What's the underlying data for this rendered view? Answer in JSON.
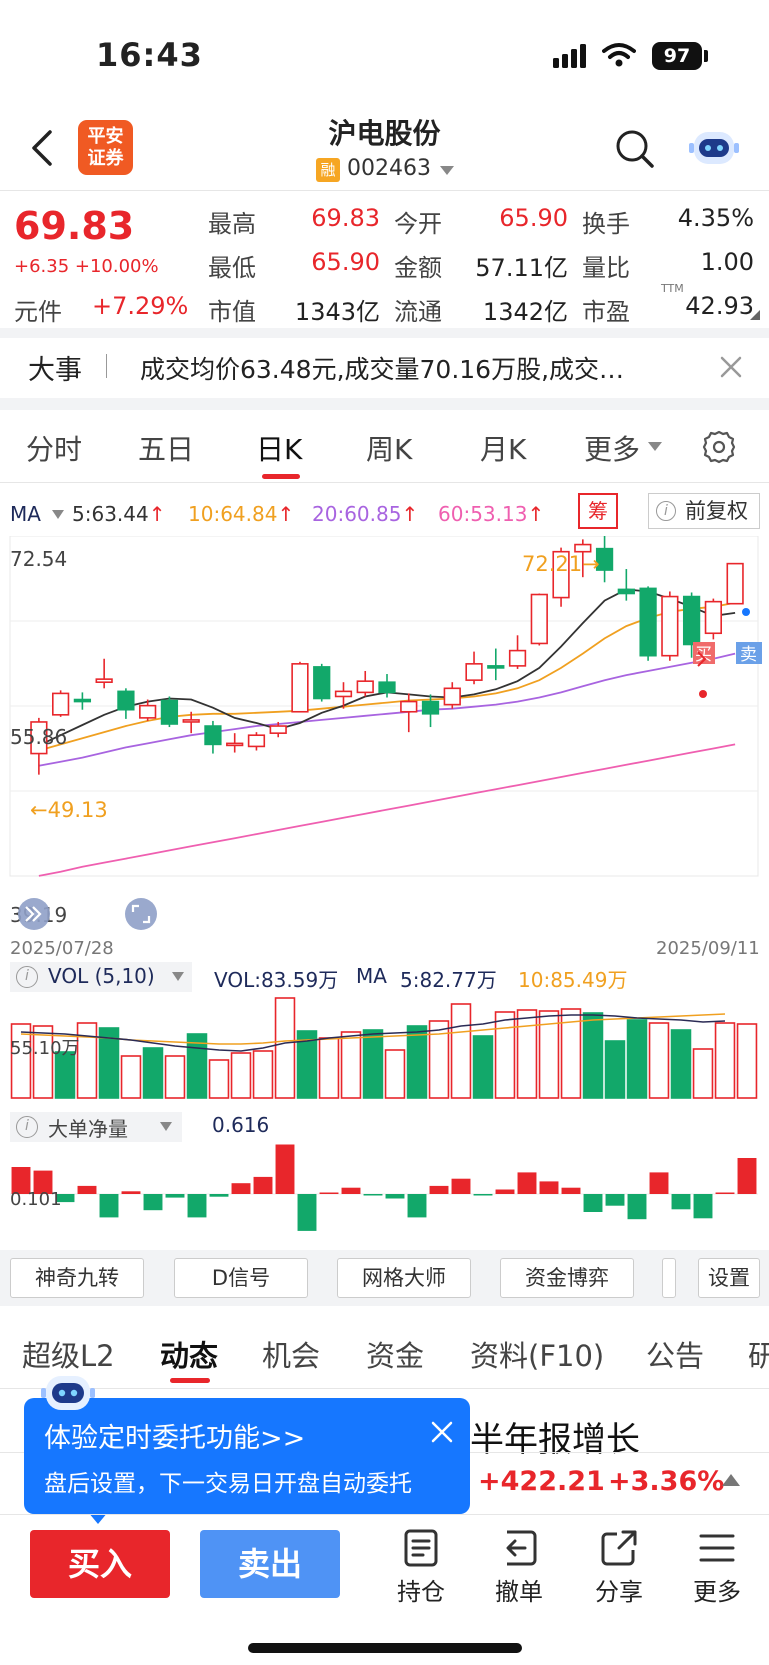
{
  "status_bar": {
    "time": "16:43",
    "battery": "97"
  },
  "header": {
    "broker_logo": "平安\n证券",
    "stock_name": "沪电股份",
    "margin_badge": "融",
    "stock_code": "002463"
  },
  "quote": {
    "price": "69.83",
    "change": "+6.35 +10.00%",
    "extra_label": "元件",
    "extra_value": "+7.29%",
    "rows": [
      [
        {
          "label": "最高",
          "value": "69.83",
          "color": "red"
        },
        {
          "label": "今开",
          "value": "65.90",
          "color": "red"
        },
        {
          "label": "换手",
          "value": "4.35%",
          "color": "black"
        }
      ],
      [
        {
          "label": "最低",
          "value": "65.90",
          "color": "red"
        },
        {
          "label": "金额",
          "value": "57.11亿",
          "color": "black"
        },
        {
          "label": "量比",
          "value": "1.00",
          "color": "black"
        }
      ],
      [
        {
          "label": "市值",
          "value": "1343亿",
          "color": "black"
        },
        {
          "label": "流通",
          "value": "1342亿",
          "color": "black"
        },
        {
          "label": "市盈",
          "value": "42.93",
          "color": "black"
        }
      ]
    ],
    "pe_suffix": "TTM"
  },
  "news": {
    "tag": "大事",
    "text": "成交均价63.48元,成交量70.16万股,成交…"
  },
  "period_tabs": [
    "分时",
    "五日",
    "日K",
    "周K",
    "月K",
    "更多"
  ],
  "active_period": "日K",
  "ma_legend": {
    "label": "MA",
    "ma5": "5:63.44",
    "ma10": "10:64.84",
    "ma20": "20:60.85",
    "ma60": "60:53.13",
    "arrow": "↑"
  },
  "chips_button": "筹",
  "adjust_button": "前复权",
  "kline": {
    "y_labels": [
      "72.54",
      "55.86",
      "39.19"
    ],
    "start_date": "2025/07/28",
    "end_date": "2025/09/11",
    "low_annotation": "49.13",
    "high_annotation": "72.21",
    "buy_mark": "买",
    "sell_mark": "卖",
    "candles": [
      {
        "o": 51.2,
        "c": 54.3,
        "h": 54.7,
        "l": 49.13
      },
      {
        "o": 55.0,
        "c": 57.1,
        "h": 57.4,
        "l": 54.8
      },
      {
        "o": 56.5,
        "c": 56.3,
        "h": 57.2,
        "l": 55.5
      },
      {
        "o": 58.2,
        "c": 58.5,
        "h": 60.5,
        "l": 57.6
      },
      {
        "o": 57.3,
        "c": 55.5,
        "h": 57.6,
        "l": 54.6
      },
      {
        "o": 54.7,
        "c": 55.9,
        "h": 56.5,
        "l": 54.4
      },
      {
        "o": 56.4,
        "c": 54.1,
        "h": 56.8,
        "l": 53.8
      },
      {
        "o": 54.3,
        "c": 54.5,
        "h": 55.3,
        "l": 53.2
      },
      {
        "o": 53.9,
        "c": 52.1,
        "h": 54.4,
        "l": 51.2
      },
      {
        "o": 52.0,
        "c": 52.2,
        "h": 53.2,
        "l": 51.3
      },
      {
        "o": 51.9,
        "c": 53.0,
        "h": 53.3,
        "l": 51.5
      },
      {
        "o": 53.2,
        "c": 53.9,
        "h": 54.3,
        "l": 52.8
      },
      {
        "o": 55.3,
        "c": 60.0,
        "h": 60.2,
        "l": 55.3
      },
      {
        "o": 59.7,
        "c": 56.6,
        "h": 60.0,
        "l": 56.3
      },
      {
        "o": 56.8,
        "c": 57.3,
        "h": 58.2,
        "l": 55.6
      },
      {
        "o": 57.2,
        "c": 58.3,
        "h": 59.3,
        "l": 56.8
      },
      {
        "o": 58.2,
        "c": 57.2,
        "h": 59.0,
        "l": 56.7
      },
      {
        "o": 55.3,
        "c": 56.3,
        "h": 57.1,
        "l": 53.3
      },
      {
        "o": 56.3,
        "c": 55.1,
        "h": 57.0,
        "l": 53.8
      },
      {
        "o": 56.0,
        "c": 57.6,
        "h": 58.2,
        "l": 55.6
      },
      {
        "o": 58.4,
        "c": 60.0,
        "h": 61.2,
        "l": 58.0
      },
      {
        "o": 59.8,
        "c": 59.6,
        "h": 61.5,
        "l": 58.4
      },
      {
        "o": 59.8,
        "c": 61.3,
        "h": 62.8,
        "l": 59.5
      },
      {
        "o": 62.0,
        "c": 66.8,
        "h": 66.9,
        "l": 61.8
      },
      {
        "o": 66.5,
        "c": 71.0,
        "h": 71.4,
        "l": 65.6
      },
      {
        "o": 71.0,
        "c": 71.7,
        "h": 72.21,
        "l": 68.5
      },
      {
        "o": 71.3,
        "c": 69.2,
        "h": 72.54,
        "l": 68.0
      },
      {
        "o": 67.3,
        "c": 66.9,
        "h": 69.3,
        "l": 66.2
      },
      {
        "o": 67.4,
        "c": 60.8,
        "h": 67.6,
        "l": 60.3
      },
      {
        "o": 60.8,
        "c": 66.6,
        "h": 67.1,
        "l": 60.3
      },
      {
        "o": 66.6,
        "c": 61.9,
        "h": 67.0,
        "l": 60.6
      },
      {
        "o": 63.0,
        "c": 66.1,
        "h": 66.4,
        "l": 62.4
      },
      {
        "o": 65.9,
        "c": 69.83,
        "h": 69.83,
        "l": 65.9
      }
    ],
    "ma5": [
      52.0,
      53.0,
      54.0,
      55.0,
      55.8,
      56.3,
      56.6,
      56.5,
      55.7,
      54.7,
      54.2,
      53.6,
      54.2,
      55.2,
      55.9,
      56.8,
      57.2,
      57.0,
      56.8,
      56.7,
      57.0,
      57.5,
      58.3,
      59.6,
      61.7,
      64.0,
      66.2,
      67.3,
      67.1,
      66.4,
      65.6,
      64.7,
      65.0
    ],
    "ma10": [
      51.5,
      52.1,
      52.7,
      53.3,
      53.9,
      54.4,
      54.8,
      55.0,
      55.1,
      55.1,
      55.2,
      55.3,
      55.4,
      55.6,
      55.8,
      56.0,
      56.2,
      56.4,
      56.5,
      56.6,
      56.8,
      57.1,
      57.6,
      58.4,
      59.6,
      61.0,
      62.5,
      63.7,
      64.5,
      65.1,
      65.4,
      65.6,
      66.0
    ],
    "ma20": [
      50.0,
      50.4,
      50.8,
      51.3,
      51.8,
      52.2,
      52.6,
      53.0,
      53.3,
      53.6,
      53.9,
      54.1,
      54.3,
      54.5,
      54.7,
      54.9,
      55.1,
      55.3,
      55.5,
      55.6,
      55.8,
      56.0,
      56.3,
      56.7,
      57.2,
      57.8,
      58.4,
      58.9,
      59.3,
      59.7,
      60.1,
      60.5,
      61.0
    ],
    "ma60": [
      39.2,
      39.6,
      40.1,
      40.5,
      40.9,
      41.3,
      41.7,
      42.1,
      42.5,
      42.9,
      43.3,
      43.7,
      44.1,
      44.5,
      44.9,
      45.3,
      45.7,
      46.1,
      46.5,
      46.9,
      47.3,
      47.7,
      48.1,
      48.5,
      48.9,
      49.3,
      49.7,
      50.1,
      50.5,
      50.9,
      51.3,
      51.7,
      52.1
    ]
  },
  "volume": {
    "legend_name": "VOL (5,10)",
    "vol": "VOL:83.59万",
    "ma_label": "MA",
    "ma5": "5:82.77万",
    "ma10": "10:85.49万",
    "axis_label": "55.10万",
    "bars": [
      74,
      72,
      46,
      75,
      70,
      42,
      50,
      42,
      64,
      38,
      45,
      47,
      100,
      67,
      60,
      66,
      68,
      48,
      72,
      77,
      94,
      62,
      86,
      88,
      87,
      89,
      85,
      57,
      78,
      75,
      68,
      49,
      75,
      74
    ],
    "ma5_line": [
      66,
      65,
      64,
      62,
      60,
      58,
      55,
      52,
      50,
      48,
      47,
      50,
      55,
      57,
      60,
      62,
      64,
      65,
      66,
      68,
      72,
      74,
      78,
      80,
      82,
      83,
      83,
      82,
      80,
      79,
      78,
      76,
      77
    ],
    "ma10_line": [
      64,
      63,
      62,
      61,
      60,
      58,
      57,
      56,
      55,
      54,
      54,
      55,
      57,
      58,
      59,
      60,
      61,
      62,
      63,
      64,
      66,
      68,
      70,
      72,
      74,
      76,
      78,
      79,
      80,
      81,
      82,
      83,
      84
    ]
  },
  "big_order": {
    "legend_name": "大单净量",
    "value": "0.616",
    "axis_label": "0.101",
    "bars": [
      30,
      26,
      -9,
      9,
      -26,
      3,
      -18,
      -4,
      -26,
      -3,
      12,
      19,
      55,
      -41,
      1,
      7,
      -1,
      -5,
      -26,
      9,
      17,
      -1,
      5,
      24,
      14,
      7,
      -20,
      -13,
      -28,
      24,
      -17,
      -27,
      1,
      40
    ]
  },
  "indicator_tools": [
    "神奇九转",
    "D信号",
    "网格大师",
    "资金博弈",
    "设置"
  ],
  "bottom_tabs": [
    "超级L2",
    "动态",
    "机会",
    "资金",
    "资料(F10)",
    "公告",
    "研"
  ],
  "active_bottom_tab": "动态",
  "headline_fragment": "半年报增长",
  "index_change": "+422.21",
  "index_pct": "+3.36%",
  "promo": {
    "title": "体验定时委托功能>>",
    "subtitle": "盘后设置，下一交易日开盘自动委托"
  },
  "actions": {
    "buy": "买入",
    "sell": "卖出",
    "position": "持仓",
    "cancel_order": "撤单",
    "share": "分享",
    "more": "更多"
  },
  "colors": {
    "up": "#e8262b",
    "down": "#12a86a",
    "ma5": "#333333",
    "ma10": "#f0a020",
    "ma20": "#a864e0",
    "ma60": "#ef5fb0",
    "accent": "#1677ff"
  }
}
